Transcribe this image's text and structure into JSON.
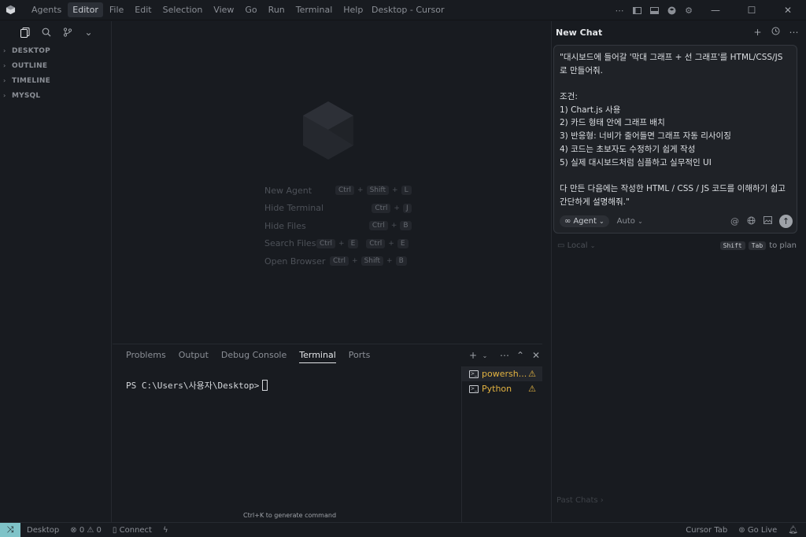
{
  "titlebar": {
    "menu": [
      "Agents",
      "Editor",
      "File",
      "Edit",
      "Selection",
      "View",
      "Go",
      "Run",
      "Terminal",
      "Help"
    ],
    "active_menu": "Editor",
    "window_title": "Desktop - Cursor",
    "controls": {
      "minimize": "—",
      "maximize": "☐",
      "close": "✕"
    }
  },
  "sidebar": {
    "sections": [
      "DESKTOP",
      "OUTLINE",
      "TIMELINE",
      "MYSQL"
    ]
  },
  "editor": {
    "shortcuts": [
      {
        "label": "New Agent",
        "keys": [
          "Ctrl",
          "Shift",
          "L"
        ]
      },
      {
        "label": "Hide Terminal",
        "keys": [
          "Ctrl",
          "J"
        ]
      },
      {
        "label": "Hide Files",
        "keys": [
          "Ctrl",
          "B"
        ]
      },
      {
        "label": "Search Files",
        "keys": [
          "Ctrl",
          "E",
          "Ctrl",
          "E"
        ]
      },
      {
        "label": "Open Browser",
        "keys": [
          "Ctrl",
          "Shift",
          "B"
        ]
      }
    ]
  },
  "panel": {
    "tabs": [
      "Problems",
      "Output",
      "Debug Console",
      "Terminal",
      "Ports"
    ],
    "active_tab": "Terminal",
    "prompt": "PS C:\\Users\\사용자\\Desktop>",
    "terminals": [
      {
        "name": "powersh...",
        "selected": true
      },
      {
        "name": "Python",
        "selected": false
      }
    ],
    "generate_hint": "Ctrl+K to generate command"
  },
  "chat": {
    "title": "New Chat",
    "message_lines": [
      "\"대시보드에 들어갈 '막대 그래프 + 선 그래프'를 HTML/CSS/JS",
      "로 만들어줘.",
      "",
      "조건:",
      "1) Chart.js 사용",
      "2) 카드 형태 안에 그래프 배치",
      "3) 반응형: 너비가 줄어들면 그래프 자동 리사이징",
      "4) 코드는 초보자도 수정하기 쉽게 작성",
      "5) 실제 대시보드처럼 심플하고 실무적인 UI",
      "",
      "다 만든 다음에는 작성한 HTML / CSS / JS 코드를 이해하기 쉽고",
      "간단하게 설명해줘.\""
    ],
    "agent_label": "Agent",
    "model_label": "Auto",
    "local_label": "Local",
    "plan_keys": [
      "Shift",
      "Tab"
    ],
    "plan_text": "to plan",
    "past_chats": "Past Chats"
  },
  "statusbar": {
    "workspace": "Desktop",
    "errors": "0",
    "warnings": "0",
    "connect": "Connect",
    "cursor_tab": "Cursor Tab",
    "go_live": "Go Live"
  },
  "colors": {
    "background": "#181b20",
    "accent_remote": "#7fc3c8",
    "warning": "#e3b341"
  }
}
